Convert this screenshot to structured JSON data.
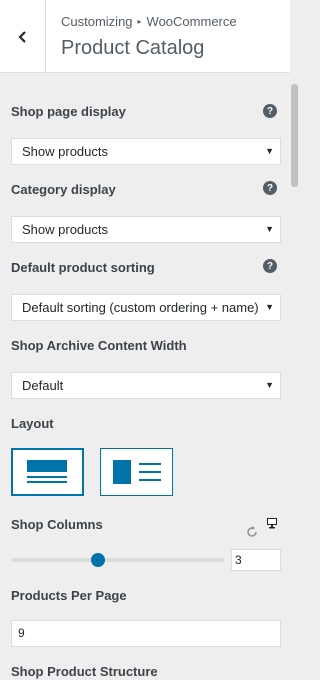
{
  "header": {
    "breadcrumb_root": "Customizing",
    "breadcrumb_sep": "▸",
    "breadcrumb_section": "WooCommerce",
    "title": "Product Catalog"
  },
  "fields": {
    "shop_page_display": {
      "label": "Shop page display",
      "help": "?",
      "value": "Show products"
    },
    "category_display": {
      "label": "Category display",
      "help": "?",
      "value": "Show products"
    },
    "default_sorting": {
      "label": "Default product sorting",
      "help": "?",
      "value": "Default sorting (custom ordering + name)"
    },
    "archive_width": {
      "label": "Shop Archive Content Width",
      "value": "Default"
    },
    "layout": {
      "label": "Layout",
      "options": [
        "grid",
        "list"
      ],
      "selected": "grid"
    },
    "shop_columns": {
      "label": "Shop Columns",
      "value": "3",
      "slider_fraction": 0.375
    },
    "products_per_page": {
      "label": "Products Per Page",
      "value": "9"
    },
    "product_structure": {
      "label": "Shop Product Structure"
    }
  },
  "select_arrow": "▼",
  "colors": {
    "accent": "#0073aa",
    "panel_bg": "#eeeeee"
  }
}
